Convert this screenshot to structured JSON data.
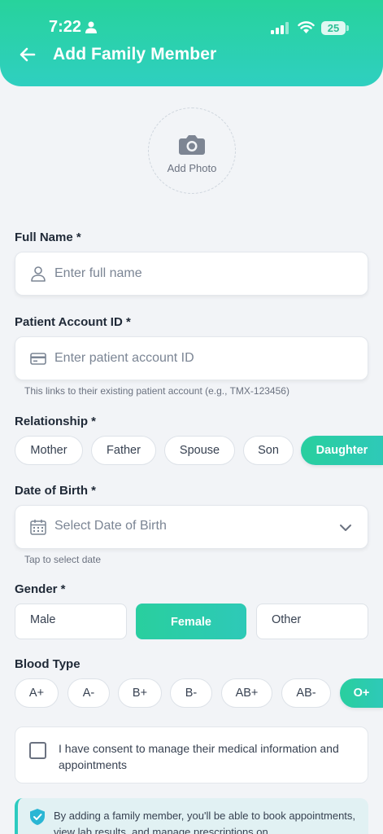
{
  "status_bar": {
    "time": "7:22",
    "battery": "25"
  },
  "header": {
    "title": "Add Family Member"
  },
  "photo": {
    "label": "Add Photo"
  },
  "full_name": {
    "label": "Full Name *",
    "placeholder": "Enter full name",
    "value": ""
  },
  "patient_id": {
    "label": "Patient Account ID *",
    "placeholder": "Enter patient account ID",
    "value": "",
    "helper": "This links to their existing patient account (e.g., TMX-123456)"
  },
  "relationship": {
    "label": "Relationship *",
    "options": [
      "Mother",
      "Father",
      "Spouse",
      "Son",
      "Daughter"
    ],
    "selected": "Daughter"
  },
  "dob": {
    "label": "Date of Birth *",
    "placeholder": "Select Date of Birth",
    "helper": "Tap to select date"
  },
  "gender": {
    "label": "Gender *",
    "options": [
      "Male",
      "Female",
      "Other"
    ],
    "selected": "Female"
  },
  "blood_type": {
    "label": "Blood Type",
    "options": [
      "A+",
      "A-",
      "B+",
      "B-",
      "AB+",
      "AB-",
      "O+"
    ],
    "selected": "O+"
  },
  "consent": {
    "text": "I have consent to manage their medical information and appointments",
    "checked": false
  },
  "info": {
    "text": "By adding a family member, you'll be able to book appointments, view lab results, and manage prescriptions on"
  },
  "colors": {
    "accent": "#2ccbac",
    "header_gradient_start": "#27d39c",
    "header_gradient_end": "#2fcfc0"
  },
  "icons": [
    "person-icon",
    "signal-icon",
    "wifi-icon",
    "back-arrow-icon",
    "camera-icon",
    "user-icon",
    "card-icon",
    "calendar-icon",
    "chevron-down-icon",
    "shield-check-icon"
  ]
}
